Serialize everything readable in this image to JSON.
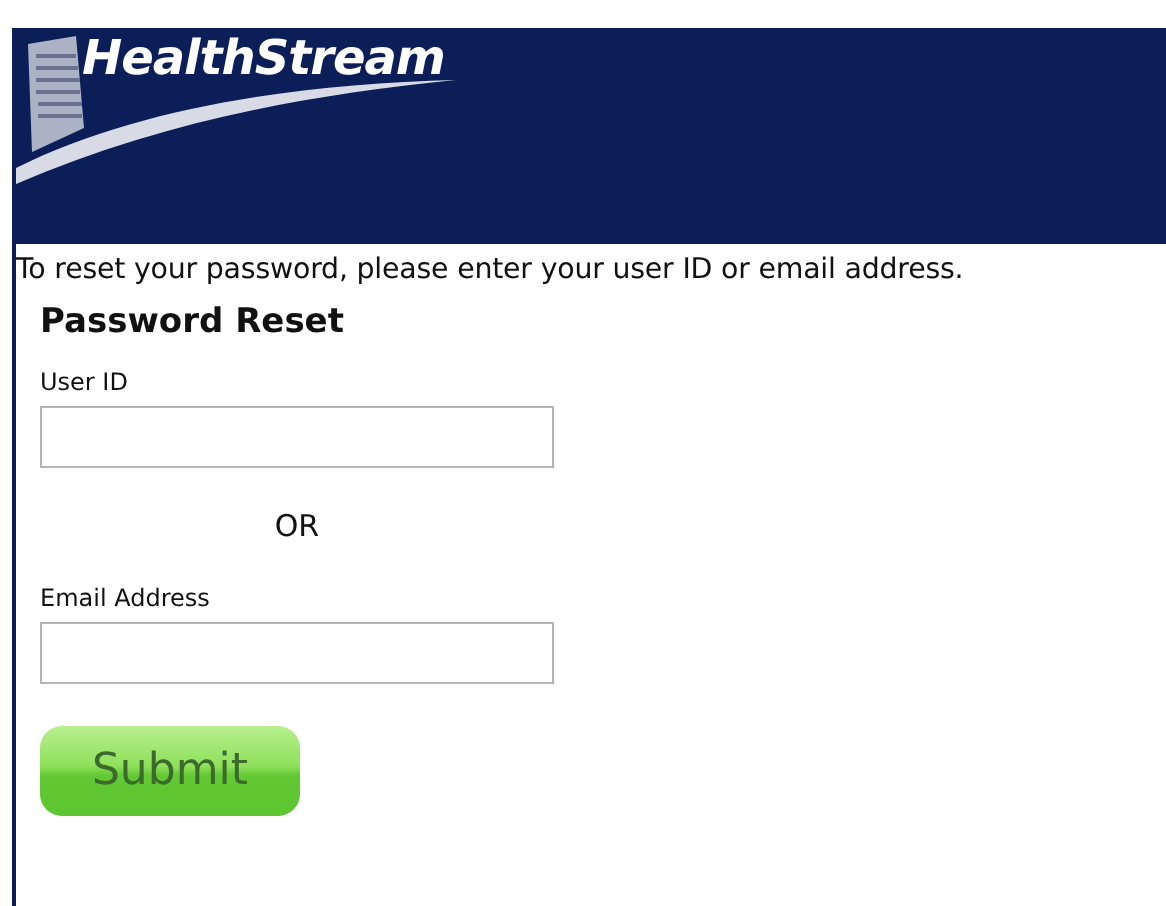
{
  "header": {
    "logo": "HealthStream"
  },
  "instructions": "To reset your password, please enter your user ID or email address.",
  "form": {
    "title": "Password Reset",
    "fields": [
      {
        "label": "User ID"
      },
      {
        "label": "Email Address"
      }
    ],
    "separator": "OR",
    "submit": "Submit"
  }
}
